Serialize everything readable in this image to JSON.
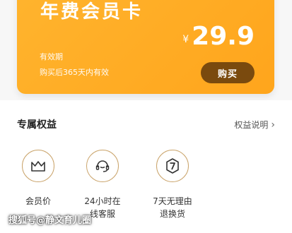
{
  "card": {
    "title": "年费会员卡",
    "currency": "¥",
    "price": "29.9",
    "validity_label": "有效期",
    "validity_desc": "购买后365天内有效",
    "buy_label": "购买"
  },
  "benefits": {
    "title": "专属权益",
    "link_label": "权益说明",
    "items": [
      {
        "icon": "crown-icon",
        "line1": "会员价",
        "line2": ""
      },
      {
        "icon": "headset-icon",
        "line1": "24小时在",
        "line2": "线客服"
      },
      {
        "icon": "return-7-icon",
        "line1": "7天无理由",
        "line2": "退换货"
      }
    ]
  },
  "watermark": "搜狐号@静文育儿圈",
  "colors": {
    "card": "#ffa81f",
    "buy_button": "#7a4a0e",
    "icon_stroke": "#333333",
    "circle_border": "#caa46b"
  }
}
